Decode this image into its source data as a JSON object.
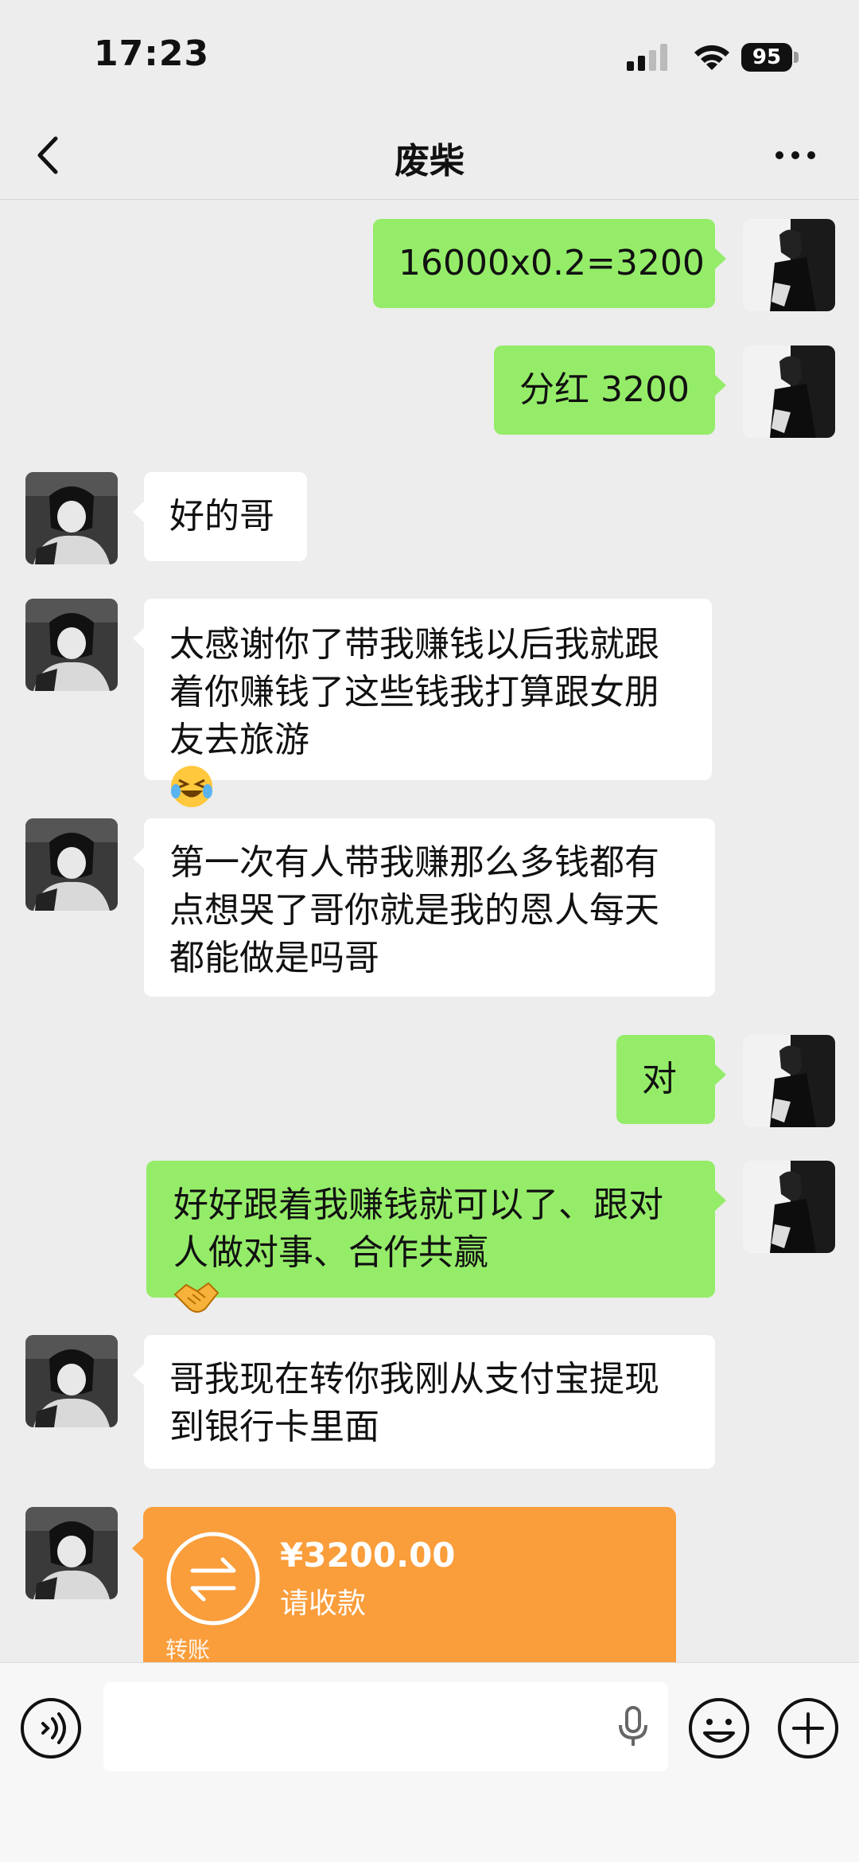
{
  "status_bar": {
    "time": "17:23",
    "battery": "95"
  },
  "header": {
    "title": "废柴"
  },
  "messages": [
    {
      "from": "me",
      "text": "16000x0.2=3200"
    },
    {
      "from": "me",
      "text": "分红 3200"
    },
    {
      "from": "other",
      "text": "好的哥"
    },
    {
      "from": "other",
      "text": "太感谢你了带我赚钱以后我就跟\n着你赚钱了这些钱我打算跟女朋\n友去旅游",
      "emoji": "laughing-tears-emoji"
    },
    {
      "from": "other",
      "text": "第一次有人带我赚那么多钱都有\n点想哭了哥你就是我的恩人每天\n都能做是吗哥"
    },
    {
      "from": "me",
      "text": "对"
    },
    {
      "from": "me",
      "text": "好好跟着我赚钱就可以了、跟对\n人做对事、合作共赢",
      "emoji": "handshake-emoji"
    },
    {
      "from": "other",
      "text": "哥我现在转你我刚从支付宝提现\n到银行卡里面"
    }
  ],
  "transfer": {
    "amount": "¥3200.00",
    "note": "请收款",
    "label": "转账",
    "color": "#fa9d3b"
  },
  "input_bar": {
    "placeholder": ""
  },
  "colors": {
    "me_bubble": "#95ec69",
    "other_bubble": "#ffffff",
    "background": "#ededed"
  }
}
